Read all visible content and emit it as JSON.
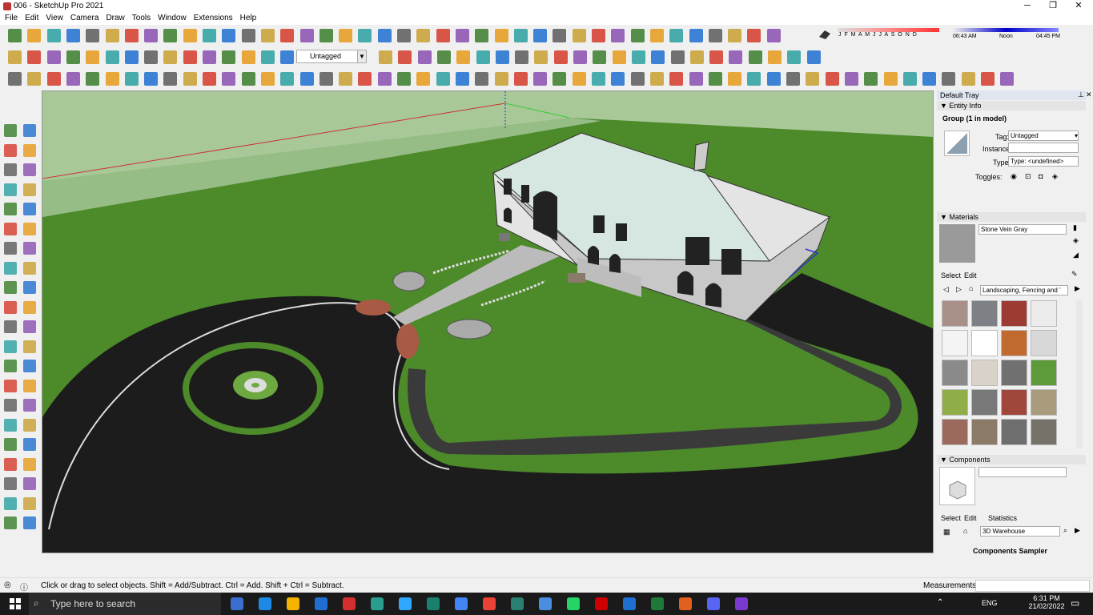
{
  "window": {
    "title": "006 - SketchUp Pro 2021",
    "minimize": "─",
    "restore": "❐",
    "close": "✕"
  },
  "menu": [
    "File",
    "Edit",
    "View",
    "Camera",
    "Draw",
    "Tools",
    "Window",
    "Extensions",
    "Help"
  ],
  "toolbar": {
    "tag_value": "Untagged"
  },
  "shadow": {
    "months": "J F M A M J J A S O N D",
    "time_start": "06:43 AM",
    "time_noon": "Noon",
    "time_end": "04:45 PM"
  },
  "tray": {
    "title": "Default Tray",
    "entity_info": {
      "header": "Entity Info",
      "selection": "Group (1 in model)",
      "tag_label": "Tag:",
      "tag_value": "Untagged",
      "instance_label": "Instance:",
      "instance_value": "",
      "type_label": "Type:",
      "type_value": "Type: <undefined>",
      "toggles_label": "Toggles:"
    },
    "materials": {
      "header": "Materials",
      "name": "Stone Vein Gray",
      "tabs": [
        "Select",
        "Edit"
      ],
      "library": "Landscaping, Fencing and '",
      "swatch_colors": [
        "#a89088",
        "#7d8084",
        "#9b3b34",
        "#ececec",
        "#f4f4f4",
        "#ffffff",
        "#c06a30",
        "#d8d8d8",
        "#8a8a8a",
        "#d8d2c8",
        "#707070",
        "#5d9a3a",
        "#8fae48",
        "#787878",
        "#a0463c",
        "#a89c7c",
        "#9c6a5c",
        "#8c7a68",
        "#6e6e6e",
        "#76726a"
      ]
    },
    "components": {
      "header": "Components",
      "tabs": [
        "Select",
        "Edit",
        "Statistics"
      ],
      "search_placeholder": "3D Warehouse",
      "sampler": "Components Sampler"
    }
  },
  "status": {
    "message": "Click or drag to select objects. Shift = Add/Subtract. Ctrl = Add. Shift + Ctrl = Subtract.",
    "measurements_label": "Measurements"
  },
  "taskbar": {
    "search_placeholder": "Type here to search",
    "lang": "ENG",
    "time": "6:31 PM",
    "date": "21/02/2022"
  }
}
